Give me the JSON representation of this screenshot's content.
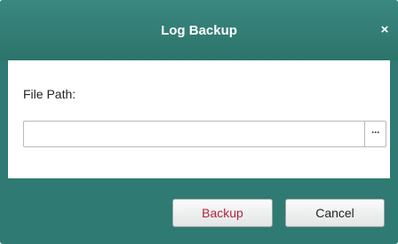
{
  "dialog": {
    "title": "Log Backup",
    "close_label": "×"
  },
  "form": {
    "file_path_label": "File Path:",
    "file_path_value": "",
    "browse_label": "···"
  },
  "buttons": {
    "backup_label": "Backup",
    "cancel_label": "Cancel"
  },
  "colors": {
    "frame": "#2f7a72",
    "backup_text": "#b1253a"
  }
}
